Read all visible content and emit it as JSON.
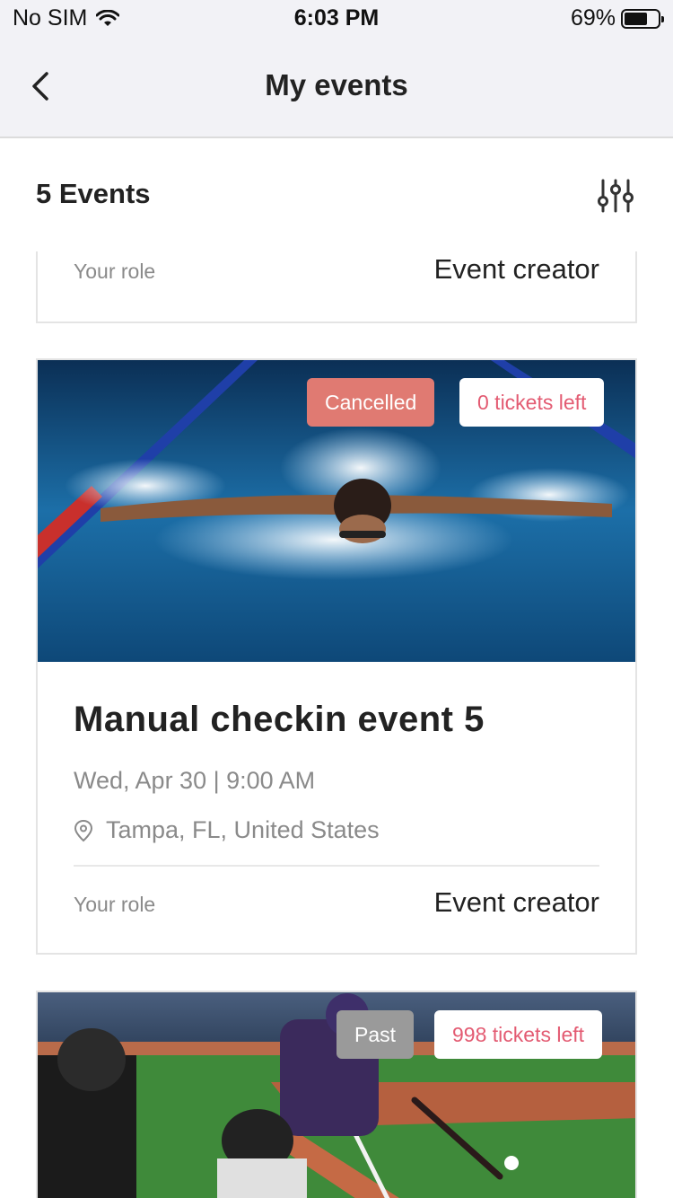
{
  "status_bar": {
    "carrier": "No SIM",
    "time": "6:03 PM",
    "battery_percent": "69%",
    "battery_level": 0.69,
    "wifi_icon": "wifi-icon"
  },
  "nav": {
    "title": "My events",
    "back_icon": "chevron-left-icon"
  },
  "header": {
    "count_label": "5 Events",
    "filter_icon": "sliders-icon"
  },
  "events": [
    {
      "role_label": "Your role",
      "role_value": "Event creator"
    },
    {
      "status_badge": "Cancelled",
      "tickets_badge": "0 tickets left",
      "title": "Manual checkin event 5",
      "datetime": "Wed, Apr 30 | 9:00 AM",
      "location": "Tampa, FL, United States",
      "role_label": "Your role",
      "role_value": "Event creator",
      "image": "swimmer-butterfly-pool-photo"
    },
    {
      "status_badge": "Past",
      "tickets_badge": "998 tickets left",
      "image": "baseball-batter-photo"
    }
  ],
  "colors": {
    "cancelled_badge": "#e07a72",
    "past_badge": "#9a9a9a",
    "tickets_text": "#e35b72",
    "nav_background": "#f2f2f6"
  }
}
